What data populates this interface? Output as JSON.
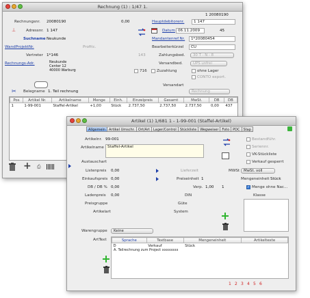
{
  "win1": {
    "title": "Rechnung (1) : 1/47 1.",
    "top_number": "1 20080190",
    "rechnungsnr_label": "Rechnungsnr.",
    "rechnungsnr_value": "20080190",
    "amount_value": "0,00",
    "haupt_label": "Hauptdebitorenr.",
    "haupt_value": "1 147",
    "adressnr_label": "Adressnr.",
    "adressnr_value": "1 147",
    "datum_label": "Datum",
    "datum_value": "06.11.2009",
    "datum_num": "45",
    "suchname_label": "Suchname",
    "suchname_value": "Neukunde",
    "mandant_label": "Mandantenref.Nr.",
    "mandant_value": "1*20080454",
    "wand_label": "WandProjektNr.",
    "wand_value": "Profitc.",
    "bearbeiter_label": "Bearbeiterkürzel",
    "bearbeiter_value": "CU",
    "vertreter_label": "Vertreter",
    "vertreter_value": "1*146",
    "vertreter_extra": "143",
    "zahlung_label": "Zahlungsbed.",
    "zahlung_value": "30 T - N - 8",
    "rechadr_label": "Rechnungs-Adr.",
    "address_lines": [
      "Neukunde",
      "Center 12",
      "40000 Warburg"
    ],
    "versand_label": "Versandbed.",
    "versand_value": "UPS unfrei",
    "chk_716": "716",
    "chk_zuzahl": "Zuzahlung",
    "chk_ohne_lager": "ohne Lager",
    "chk_conto": "CONTO export.",
    "versandart_label": "Versandart",
    "belegname_label": "Belegname",
    "belegname_value": "1. Teil rechnung",
    "rechnung_popup": "Rechnung",
    "table_headers": [
      "Pos",
      "Artikel Nr.",
      "Artikelname",
      "Menge",
      "Einh.",
      "Einzelpreis",
      "Gesamt",
      "MwSt.",
      "DB",
      "DB"
    ],
    "table_rows": [
      [
        "1",
        "1-99-001",
        "Staffel-Artikel",
        "+1,00",
        "Stück",
        "2.737,50",
        "2.737,50",
        "2.737,50",
        "0,00",
        "437"
      ]
    ]
  },
  "win2": {
    "title": "Artikel (1) 1/681 1 - 1-99-001 (Staffel-Artikel)",
    "tabs": [
      "Allgemein",
      "Artikel Umschr.",
      "Ort/Art",
      "Lager/Control",
      "Stückliste",
      "Wegweiser",
      "Foto",
      "PDC",
      "Stap"
    ],
    "artnr_label": "Artikelnr.",
    "artnr_value": "99-001",
    "artname_label": "Artikelname",
    "artname_value": "Staffel-Artikel",
    "chk_bestandfuehr": "Bestandführ.",
    "chk_seriennr": "Seriennr.",
    "chk_vkstueck": "VK-Stückliste",
    "chk_verkauf": "Verkauf gesperrt",
    "austausch_label": "Austauschart",
    "listenpreis_label": "Listenpreis",
    "listenpreis_value": "0,00",
    "lieferzeit_label": "Lieferzeit",
    "mwst_label": "MWSt",
    "mwst_value": "MwSt. voll",
    "ek_label": "Einkaufspreis",
    "ek_value": "0,00",
    "preiseinheit_label": "Preiseinheit",
    "preiseinheit_value": "1",
    "mengeneinheit_label": "Mengeneinheit",
    "mengeneinheit_value": "Stück",
    "db_label": "DB / DB %",
    "db_value": "0,00",
    "verp_label": "Verp.",
    "verp_value": "1,00",
    "verp_unit": "1",
    "chk_menge_ohne": "Menge ohne Nac...",
    "ladenpreis_label": "Ladenpreis",
    "ladenpreis_value": "0,00",
    "din_label": "DIN",
    "klasse_label": "Klasse",
    "preisgruppe_label": "Preisgruppe",
    "guete_label": "Güte",
    "artikelart_label": "Artikelart",
    "system_label": "System",
    "warengruppe_label": "Warengruppe",
    "warengruppe_value": "Keine",
    "arttext_label": "ArtText",
    "arttext_headers": [
      "Sprache",
      "Textbase",
      "Mengeneinheit",
      "Artikeltexte"
    ],
    "arttext_row": [
      "D",
      "Verkauf",
      "Stück",
      ""
    ],
    "arttext_note": "A. Teilrechnung zum Project xxxxxxxx",
    "pages": [
      "1",
      "2",
      "3",
      "4",
      "5",
      "6"
    ]
  },
  "colors": {
    "accent": "#1d3ea8",
    "tab_active": "#7aaaf0",
    "add_green": "#2fb52f",
    "page_red": "#d02020"
  },
  "icons": [
    "app-icon",
    "refresh-arrows-icon",
    "calendar-icon",
    "speech-bubble-icon",
    "trash-icon",
    "plus-icon",
    "scissors-icon",
    "barcode-icon",
    "print-icon"
  ]
}
